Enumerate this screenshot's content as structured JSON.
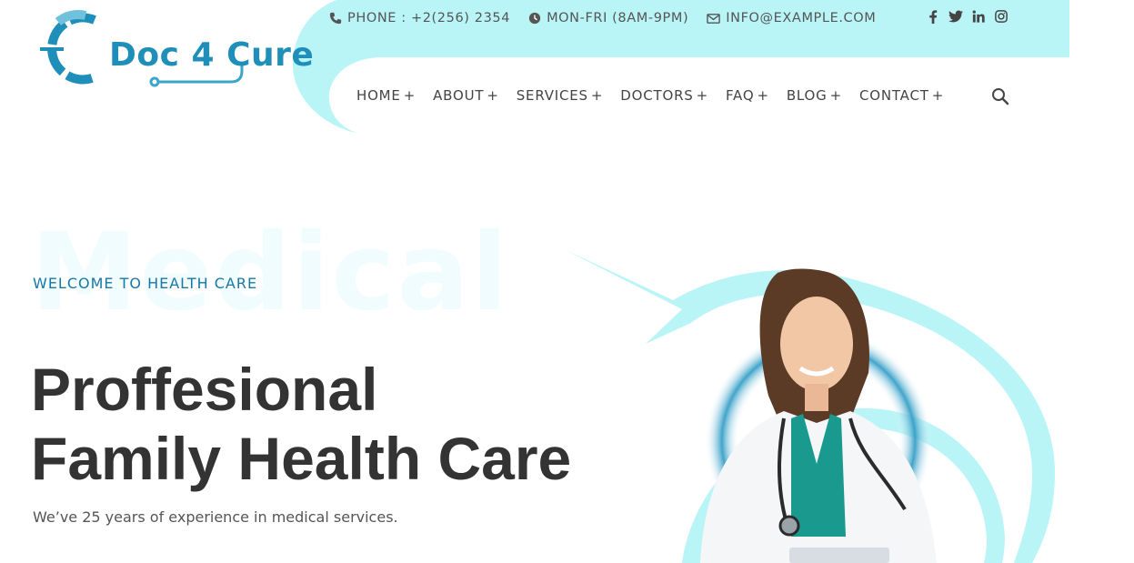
{
  "brand": {
    "logo_text": "Doc 4 Cure",
    "primary_color": "#1f8fb9",
    "accent_color": "#b9f5f7"
  },
  "topbar": {
    "phone": "PHONE : +2(256) 2354",
    "hours": "MON-FRI (8AM-9PM)",
    "email": "INFO@EXAMPLE.COM",
    "social_icons": [
      "facebook-icon",
      "twitter-icon",
      "linkedin-icon",
      "instagram-icon"
    ]
  },
  "nav": {
    "items": [
      {
        "label": "HOME",
        "suffix": "+"
      },
      {
        "label": "ABOUT",
        "suffix": "+"
      },
      {
        "label": "SERVICES",
        "suffix": "+"
      },
      {
        "label": "DOCTORS",
        "suffix": "+"
      },
      {
        "label": "FAQ",
        "suffix": "+"
      },
      {
        "label": "BLOG",
        "suffix": "+"
      },
      {
        "label": "CONTACT",
        "suffix": "+"
      }
    ],
    "search_icon": "search-icon"
  },
  "hero": {
    "watermark": "Medical",
    "eyebrow": "WELCOME TO HEALTH CARE",
    "headline_line1": "Proffesional",
    "headline_line2": "Family Health Care",
    "subtext": "We’ve 25 years of experience in medical services."
  }
}
